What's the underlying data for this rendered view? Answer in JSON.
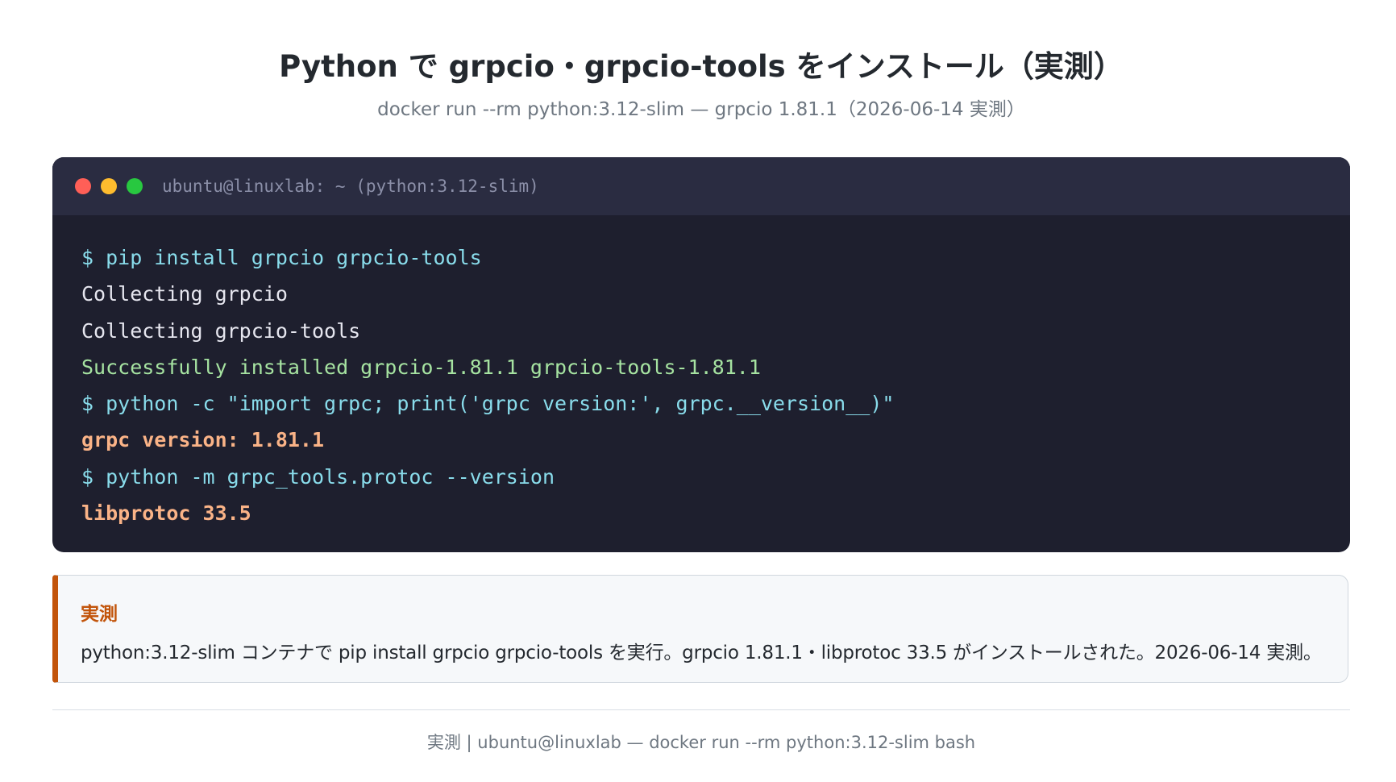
{
  "header": {
    "title": "Python で grpcio・grpcio-tools をインストール（実測）",
    "subtitle": "docker run --rm python:3.12-slim — grpcio 1.81.1（2026-06-14 実測）"
  },
  "terminal": {
    "window_title": "ubuntu@linuxlab: ~ (python:3.12-slim)",
    "dot_colors": [
      "#ff5f57",
      "#febc2e",
      "#28c840"
    ],
    "lines": [
      {
        "kind": "cmd",
        "text": "$ pip install grpcio grpcio-tools"
      },
      {
        "kind": "out",
        "text": "Collecting grpcio"
      },
      {
        "kind": "out",
        "text": "Collecting grpcio-tools"
      },
      {
        "kind": "ok",
        "text": "Successfully installed grpcio-1.81.1 grpcio-tools-1.81.1"
      },
      {
        "kind": "cmd",
        "text": "$ python -c \"import grpc; print('grpc version:', grpc.__version__)\""
      },
      {
        "kind": "res",
        "text": "grpc version: 1.81.1"
      },
      {
        "kind": "cmd",
        "text": "$ python -m grpc_tools.protoc --version"
      },
      {
        "kind": "res",
        "text": "libprotoc 33.5"
      }
    ]
  },
  "callout": {
    "label": "実測",
    "text": "python:3.12-slim コンテナで pip install grpcio grpcio-tools を実行。grpcio 1.81.1・libprotoc 33.5 がインストールされた。2026-06-14 実測。"
  },
  "footer": {
    "text": "実測 | ubuntu@linuxlab — docker run --rm python:3.12-slim bash"
  },
  "colors": {
    "terminal_bg": "#1e1f2e",
    "titlebar_bg": "#2a2c41",
    "command": "#89dceb",
    "output": "#e6e6ef",
    "success": "#a6e3a1",
    "result": "#fab387",
    "accent": "#c2540a"
  }
}
